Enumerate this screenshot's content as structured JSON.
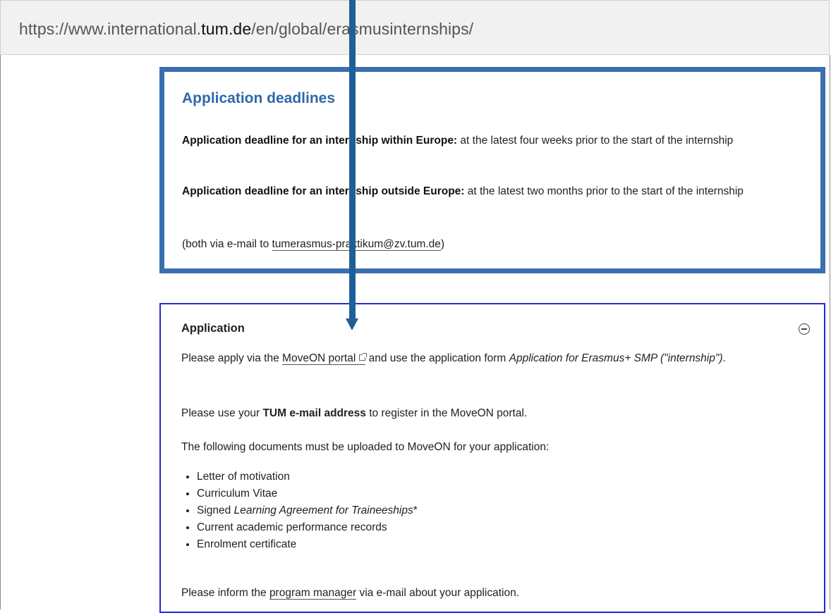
{
  "url": {
    "prefix": "https://www.international.",
    "domain": "tum.de",
    "path": "/en/global/erasmusinternships/"
  },
  "deadlines": {
    "title": "Application deadlines",
    "p1_bold": "Application deadline for an internship within Europe:",
    "p1_text": " at the latest four weeks prior to the start of the internship",
    "p2_bold": "Application deadline for an internship outside Europe:",
    "p2_text": " at the latest two months prior to the start of the internship",
    "p3_before": "(both via e-mail to ",
    "p3_email": "tumerasmus-praktikum@zv.tum.de",
    "p3_after": ")"
  },
  "application": {
    "title": "Application",
    "p1_before": "Please apply via the ",
    "p1_link": "MoveON portal",
    "p1_middle": " and use the application form ",
    "p1_italic": "Application for Erasmus+ SMP (\"internship\")",
    "p1_end": ".",
    "p2_before": "Please use your ",
    "p2_bold": "TUM e-mail address",
    "p2_after": " to register in the MoveON portal.",
    "p3": "The following documents must be uploaded to MoveON for your application:",
    "docs": [
      "Letter of motivation",
      "Curriculum Vitae",
      "Signed ",
      "Current academic performance records",
      "Enrolment certificate"
    ],
    "doc3_italic": "Learning Agreement for Traineeships",
    "doc3_after": "*",
    "p4_before": "Please inform the ",
    "p4_link": "program manager",
    "p4_after": " via e-mail about your application."
  },
  "colors": {
    "heading_blue": "#2f68aa",
    "highlight_border": "#3a6fb0",
    "application_border": "#2828d8",
    "arrow": "#1f5f98"
  }
}
